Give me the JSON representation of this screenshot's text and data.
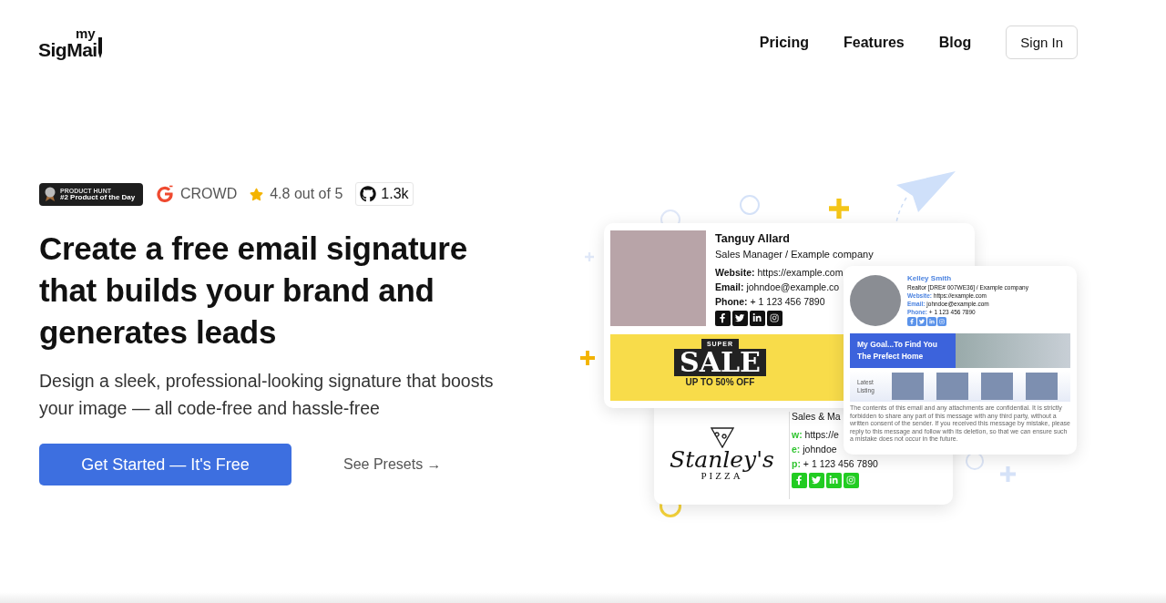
{
  "nav": {
    "logo": {
      "top": "my",
      "main": "SigMai"
    },
    "links": [
      "Pricing",
      "Features",
      "Blog"
    ],
    "sign_in": "Sign In"
  },
  "badges": {
    "product_hunt": {
      "kicker": "PRODUCT HUNT",
      "title": "#2 Product of the Day"
    },
    "g2": "CROWD",
    "rating": "4.8 out of 5",
    "github": "1.3k"
  },
  "hero": {
    "title": "Create a free email signature that builds your brand and generates leads",
    "subtitle": "Design a sleek, professional-looking signature that boosts your image — all code-free and hassle-free",
    "primary_button": "Get Started — It's Free",
    "secondary_link": "See Presets →"
  },
  "signatures": {
    "main": {
      "name": "Tanguy Allard",
      "role": "Sales Manager  /  Example company",
      "lines": [
        {
          "label": "Website:",
          "value": "https://example.com"
        },
        {
          "label": "Email:",
          "value": "johndoe@example.co"
        },
        {
          "label": "Phone:",
          "value": "+ 1 123 456 7890"
        }
      ],
      "banner": {
        "kicker": "SUPER",
        "title": "SALE",
        "subtitle": "UP TO 50% OFF"
      }
    },
    "pizza": {
      "logo_script": "Stanley's",
      "logo_word": "PIZZA",
      "role": "Sales & Ma",
      "lines": [
        {
          "label": "w:",
          "value": "https://e"
        },
        {
          "label": "e:",
          "value": "johndoe"
        },
        {
          "label": "p:",
          "value": "+ 1 123 456 7890"
        }
      ]
    },
    "realtor": {
      "name": "Kelley Smith",
      "role": "Realtor [DRE# 007WE36]  /  Example company",
      "lines": [
        {
          "label": "Website:",
          "value": "https://example.com"
        },
        {
          "label": "Email:",
          "value": "johndoe@example.com"
        },
        {
          "label": "Phone:",
          "value": "+ 1 123 456 7890"
        }
      ],
      "banner": "My Goal...To Find You The Prefect Home",
      "listing_label": "Latest Listing",
      "disclaimer": "The contents of this email and any attachments are confidential. It is strictly forbidden to share any part of this message with any third party, without a written consent of the sender. If you received this message by mistake, please reply to this message and follow with its deletion, so that we can ensure such a mistake does not occur in the future."
    }
  }
}
